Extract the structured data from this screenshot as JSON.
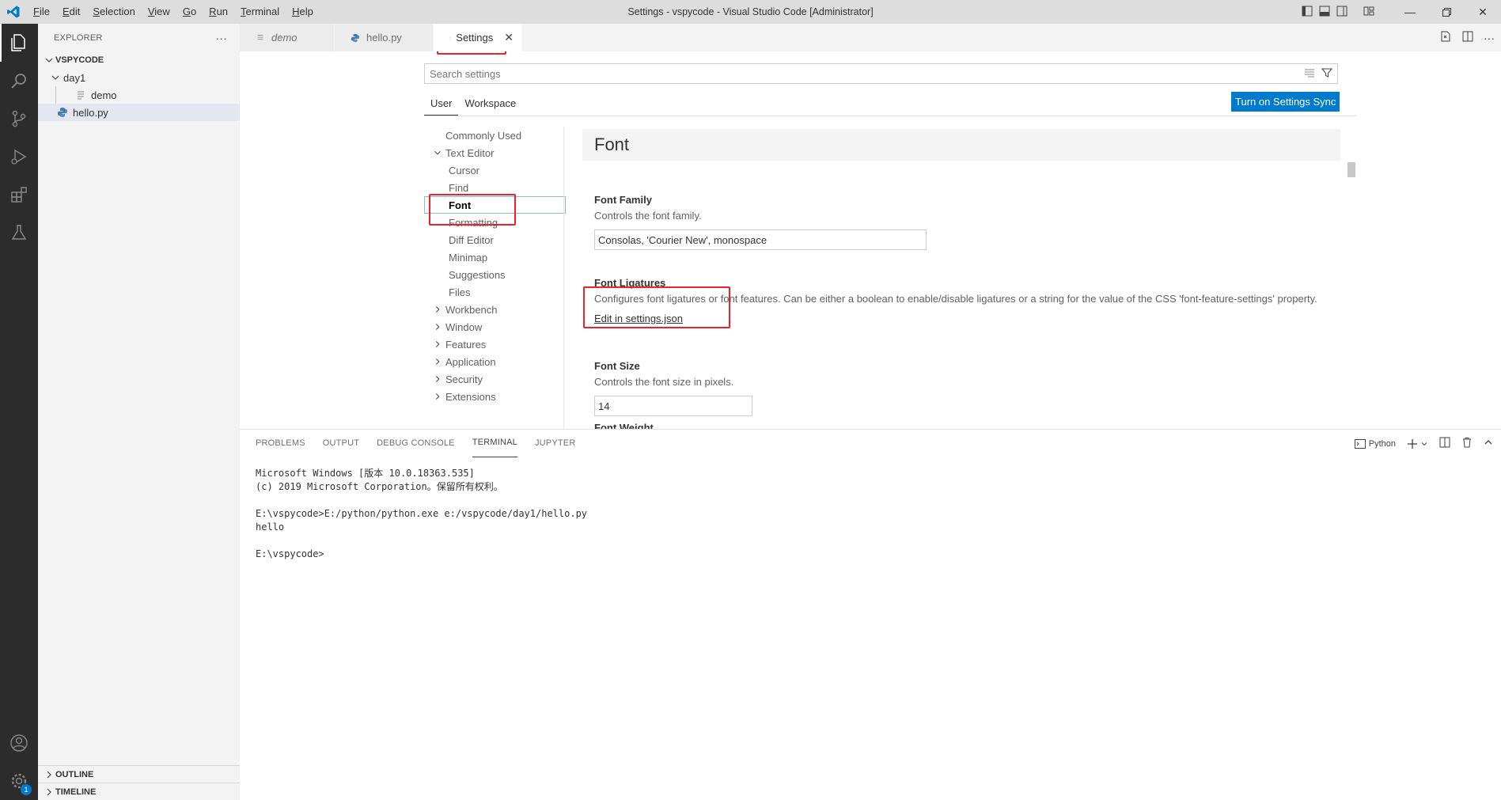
{
  "window": {
    "title": "Settings - vspycode - Visual Studio Code [Administrator]"
  },
  "menu": [
    "File",
    "Edit",
    "Selection",
    "View",
    "Go",
    "Run",
    "Terminal",
    "Help"
  ],
  "menu_mnemonics": [
    "F",
    "E",
    "S",
    "V",
    "G",
    "R",
    "T",
    "H"
  ],
  "colors": {
    "accent": "#007acc",
    "highlight_box": "#e8232a",
    "activity_bar": "#2c2c2c"
  },
  "activity": {
    "items": [
      "explorer-icon",
      "search-icon",
      "source-control-icon",
      "run-debug-icon",
      "extensions-icon",
      "testing-icon"
    ],
    "bottom": [
      "account-icon",
      "manage-gear-icon"
    ],
    "manage_badge": "1"
  },
  "sidebar": {
    "title": "EXPLORER",
    "more": "···",
    "folder": "VSPYCODE",
    "subfolder": "day1",
    "files": [
      "demo",
      "hello.py"
    ],
    "outline": "OUTLINE",
    "timeline": "TIMELINE"
  },
  "tabs": [
    {
      "label": "demo",
      "italic": true
    },
    {
      "label": "hello.py",
      "italic": false
    },
    {
      "label": "Settings",
      "active": true
    }
  ],
  "settings": {
    "search_placeholder": "Search settings",
    "scope_tabs": [
      "User",
      "Workspace"
    ],
    "sync_button": "Turn on Settings Sync",
    "toc": [
      {
        "label": "Commonly Used",
        "level": 0,
        "chevron": ""
      },
      {
        "label": "Text Editor",
        "level": 0,
        "chevron": "open"
      },
      {
        "label": "Cursor",
        "level": 1,
        "chevron": ""
      },
      {
        "label": "Find",
        "level": 1,
        "chevron": ""
      },
      {
        "label": "Font",
        "level": 1,
        "chevron": "",
        "selected": true
      },
      {
        "label": "Formatting",
        "level": 1,
        "chevron": ""
      },
      {
        "label": "Diff Editor",
        "level": 1,
        "chevron": ""
      },
      {
        "label": "Minimap",
        "level": 1,
        "chevron": ""
      },
      {
        "label": "Suggestions",
        "level": 1,
        "chevron": ""
      },
      {
        "label": "Files",
        "level": 1,
        "chevron": ""
      },
      {
        "label": "Workbench",
        "level": 0,
        "chevron": "closed"
      },
      {
        "label": "Window",
        "level": 0,
        "chevron": "closed"
      },
      {
        "label": "Features",
        "level": 0,
        "chevron": "closed"
      },
      {
        "label": "Application",
        "level": 0,
        "chevron": "closed"
      },
      {
        "label": "Security",
        "level": 0,
        "chevron": "closed"
      },
      {
        "label": "Extensions",
        "level": 0,
        "chevron": "closed"
      }
    ],
    "group_title": "Font",
    "font_family": {
      "label": "Font Family",
      "description": "Controls the font family.",
      "value": "Consolas, 'Courier New', monospace"
    },
    "font_ligatures": {
      "label": "Font Ligatures",
      "description": "Configures font ligatures or font features. Can be either a boolean to enable/disable ligatures or a string for the value of the CSS 'font-feature-settings' property.",
      "link": "Edit in settings.json"
    },
    "font_size": {
      "label": "Font Size",
      "description": "Controls the font size in pixels.",
      "value": "14"
    },
    "font_weight": {
      "label": "Font Weight"
    }
  },
  "panel": {
    "tabs": [
      "PROBLEMS",
      "OUTPUT",
      "DEBUG CONSOLE",
      "TERMINAL",
      "JUPYTER"
    ],
    "active_tab": "TERMINAL",
    "terminal_name": "Python",
    "terminal_lines": [
      "Microsoft Windows [版本 10.0.18363.535]",
      "(c) 2019 Microsoft Corporation。保留所有权利。",
      "",
      "E:\\vspycode>E:/python/python.exe e:/vspycode/day1/hello.py",
      "hello",
      "",
      "E:\\vspycode>"
    ]
  }
}
